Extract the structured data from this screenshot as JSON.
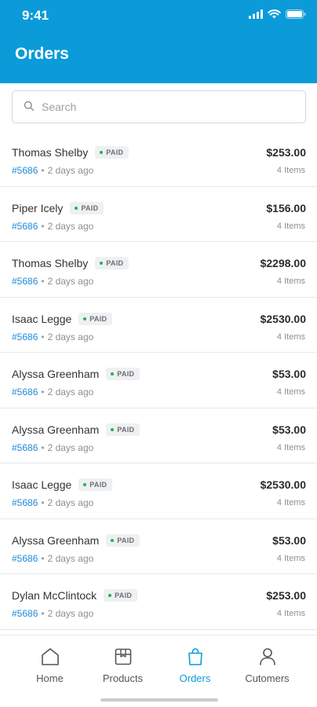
{
  "status_bar": {
    "time": "9:41"
  },
  "header": {
    "title": "Orders"
  },
  "search": {
    "placeholder": "Search"
  },
  "orders": [
    {
      "name": "Thomas Shelby",
      "status": "PAID",
      "order_id": "#5686",
      "ago": "2 days ago",
      "amount": "$253.00",
      "items": "4 Items"
    },
    {
      "name": "Piper Icely",
      "status": "PAID",
      "order_id": "#5686",
      "ago": "2 days ago",
      "amount": "$156.00",
      "items": "4 Items"
    },
    {
      "name": "Thomas Shelby",
      "status": "PAID",
      "order_id": "#5686",
      "ago": "2 days ago",
      "amount": "$2298.00",
      "items": "4 Items"
    },
    {
      "name": "Isaac Legge",
      "status": "PAID",
      "order_id": "#5686",
      "ago": "2 days ago",
      "amount": "$2530.00",
      "items": "4 Items"
    },
    {
      "name": "Alyssa Greenham",
      "status": "PAID",
      "order_id": "#5686",
      "ago": "2 days ago",
      "amount": "$53.00",
      "items": "4 Items"
    },
    {
      "name": "Alyssa Greenham",
      "status": "PAID",
      "order_id": "#5686",
      "ago": "2 days ago",
      "amount": "$53.00",
      "items": "4 Items"
    },
    {
      "name": "Isaac Legge",
      "status": "PAID",
      "order_id": "#5686",
      "ago": "2 days ago",
      "amount": "$2530.00",
      "items": "4 Items"
    },
    {
      "name": "Alyssa Greenham",
      "status": "PAID",
      "order_id": "#5686",
      "ago": "2 days ago",
      "amount": "$53.00",
      "items": "4 Items"
    },
    {
      "name": "Dylan McClintock",
      "status": "PAID",
      "order_id": "#5686",
      "ago": "2 days ago",
      "amount": "$253.00",
      "items": "4 Items"
    }
  ],
  "tabbar": {
    "active": "orders",
    "tabs": [
      {
        "key": "home",
        "label": "Home",
        "icon": "home-icon"
      },
      {
        "key": "products",
        "label": "Products",
        "icon": "box-icon"
      },
      {
        "key": "orders",
        "label": "Orders",
        "icon": "shopping-bag-icon"
      },
      {
        "key": "customers",
        "label": "Cutomers",
        "icon": "user-icon"
      }
    ]
  },
  "colors": {
    "accent": "#0a9bd8",
    "paid_dot": "#22b24c",
    "order_id": "#1f8ad6"
  }
}
